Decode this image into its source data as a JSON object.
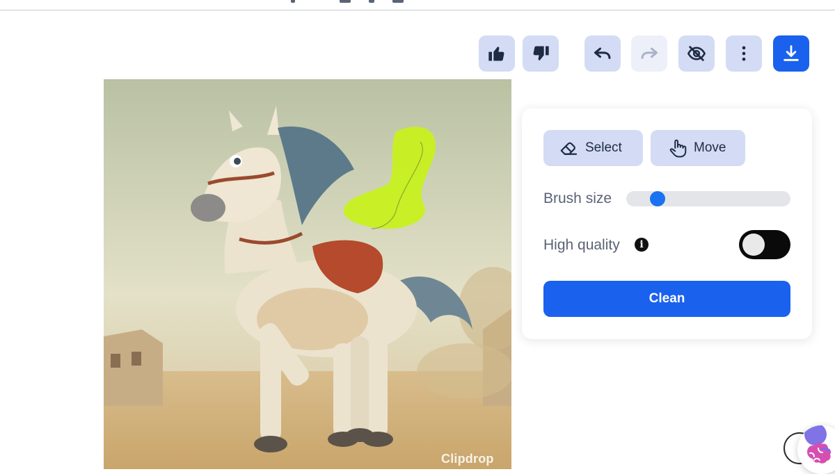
{
  "toolbar": {
    "items": [
      {
        "name": "thumbs-up",
        "icon": "thumbs-up-icon"
      },
      {
        "name": "thumbs-down",
        "icon": "thumbs-down-icon"
      },
      {
        "name": "undo",
        "icon": "undo-icon"
      },
      {
        "name": "redo",
        "icon": "redo-icon",
        "disabled": true
      },
      {
        "name": "hide",
        "icon": "eye-off-icon"
      },
      {
        "name": "more",
        "icon": "more-vertical-icon"
      },
      {
        "name": "download",
        "icon": "download-icon"
      }
    ]
  },
  "canvas": {
    "watermark": "Clipdrop"
  },
  "panel": {
    "select_label": "Select",
    "move_label": "Move",
    "brush_size_label": "Brush size",
    "brush_size_value": 0.16,
    "high_quality_label": "High quality",
    "high_quality_on": false,
    "clean_label": "Clean"
  },
  "colors": {
    "accent": "#1a61ee",
    "button_bg": "#d3dcf4",
    "mask_highlight": "#c8f21a"
  }
}
